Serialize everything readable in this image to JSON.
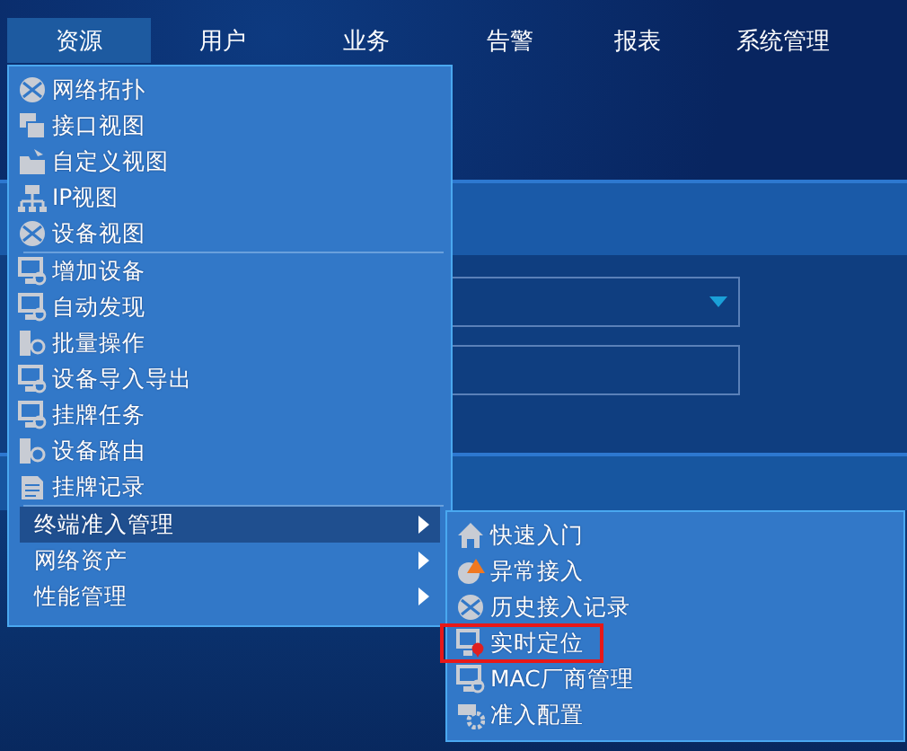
{
  "nav": {
    "tabs": [
      {
        "label": "资源",
        "selected": true
      },
      {
        "label": "用户",
        "selected": false
      },
      {
        "label": "业务",
        "selected": false
      },
      {
        "label": "告警",
        "selected": false
      },
      {
        "label": "报表",
        "selected": false
      },
      {
        "label": "系统管理",
        "selected": false
      }
    ]
  },
  "menu": {
    "groups": [
      [
        {
          "kind": "command",
          "label": "网络拓扑"
        },
        {
          "kind": "command",
          "label": "接口视图"
        },
        {
          "kind": "command",
          "label": "自定义视图"
        },
        {
          "kind": "command",
          "label": "IP视图"
        },
        {
          "kind": "command",
          "label": "设备视图"
        }
      ],
      [
        {
          "kind": "command",
          "label": "增加设备"
        },
        {
          "kind": "command",
          "label": "自动发现"
        },
        {
          "kind": "command",
          "label": "批量操作"
        },
        {
          "kind": "command",
          "label": "设备导入导出"
        },
        {
          "kind": "command",
          "label": "挂牌任务"
        },
        {
          "kind": "command",
          "label": "设备路由"
        },
        {
          "kind": "command",
          "label": "挂牌记录"
        }
      ],
      [
        {
          "kind": "submenu",
          "label": "终端准入管理",
          "expanded": true
        },
        {
          "kind": "submenu",
          "label": "网络资产",
          "expanded": false
        },
        {
          "kind": "submenu",
          "label": "性能管理",
          "expanded": false
        }
      ]
    ]
  },
  "submenu": {
    "items": [
      {
        "label": "快速入门",
        "marked": false
      },
      {
        "label": "异常接入",
        "marked": false
      },
      {
        "label": "历史接入记录",
        "marked": false
      },
      {
        "label": "实时定位",
        "marked": true
      },
      {
        "label": "MAC厂商管理",
        "marked": false
      },
      {
        "label": "准入配置",
        "marked": false
      }
    ]
  }
}
